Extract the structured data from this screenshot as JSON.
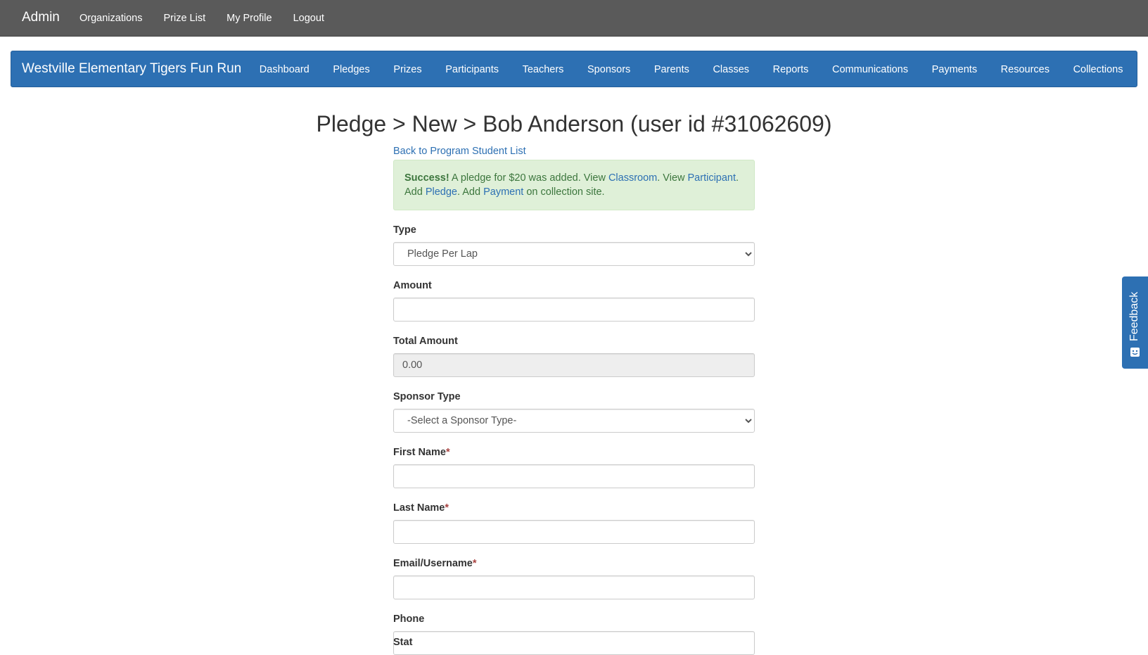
{
  "topbar": {
    "brand": "Admin",
    "nav": [
      "Organizations",
      "Prize List",
      "My Profile",
      "Logout"
    ]
  },
  "orgbar": {
    "brand": "Westville Elementary Tigers Fun Run",
    "nav": [
      "Dashboard",
      "Pledges",
      "Prizes",
      "Participants",
      "Teachers",
      "Sponsors",
      "Parents",
      "Classes",
      "Reports",
      "Communications",
      "Payments",
      "Resources",
      "Collections"
    ]
  },
  "page": {
    "title": "Pledge > New > Bob Anderson (user id #31062609)",
    "back_link": "Back to Program Student List"
  },
  "alert": {
    "strong": "Success!",
    "text1": " A pledge for $20 was added. View ",
    "link_classroom": "Classroom",
    "text2": ". View ",
    "link_participant": "Participant",
    "text3": ". Add ",
    "link_pledge": "Pledge",
    "text4": ". Add ",
    "link_payment": "Payment",
    "text5": " on collection site."
  },
  "form": {
    "type_label": "Type",
    "type_selected": "Pledge Per Lap",
    "amount_label": "Amount",
    "amount_value": "",
    "total_label": "Total Amount",
    "total_value": "0.00",
    "sponsor_type_label": "Sponsor Type",
    "sponsor_type_selected": "-Select a Sponsor Type-",
    "first_name_label": "First Name",
    "last_name_label": "Last Name",
    "email_label": "Email/Username",
    "phone_label": "Phone",
    "required_mark": "*",
    "next_label_cut": "Stat"
  },
  "feedback": {
    "label": "Feedback",
    "icon": "smile-face-icon"
  },
  "colors": {
    "topbar": "#5a5a5a",
    "orgbar": "#2d70b3",
    "alert_bg": "#dff0d8",
    "alert_text": "#3c763d",
    "link": "#2d70b3"
  }
}
